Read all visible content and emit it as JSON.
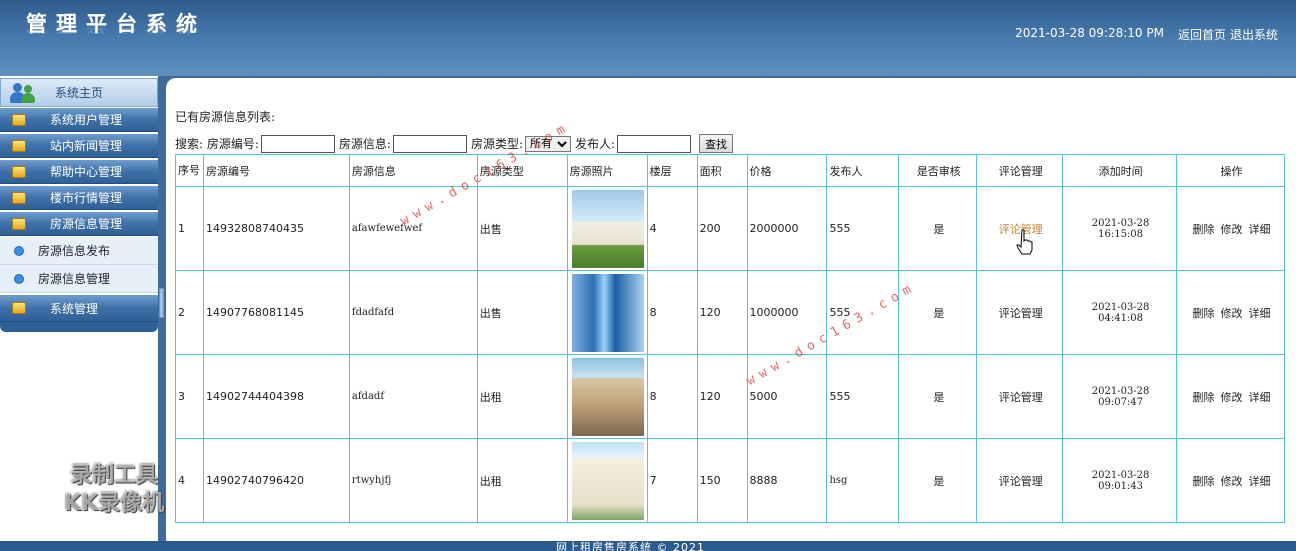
{
  "header": {
    "app_title": "管理平台系统",
    "datetime": "2021-03-28 09:28:10 PM",
    "home_link": "返回首页",
    "logout_link": "退出系统"
  },
  "sidebar": {
    "home": "系统主页",
    "items": [
      {
        "label": "系统用户管理"
      },
      {
        "label": "站内新闻管理"
      },
      {
        "label": "帮助中心管理"
      },
      {
        "label": "楼市行情管理"
      },
      {
        "label": "房源信息管理"
      }
    ],
    "sub_items": [
      {
        "label": "房源信息发布"
      },
      {
        "label": "房源信息管理"
      }
    ],
    "system_item": "系统管理"
  },
  "main": {
    "list_title": "已有房源信息列表:",
    "search": {
      "label": "搜索:",
      "field_id_label": "房源编号:",
      "field_info_label": "房源信息:",
      "field_type_label": "房源类型:",
      "type_selected": "所有",
      "field_publisher_label": "发布人:",
      "button": "查找"
    },
    "columns": [
      "序号",
      "房源编号",
      "房源信息",
      "房源类型",
      "房源照片",
      "楼层",
      "面积",
      "价格",
      "发布人",
      "是否审核",
      "评论管理",
      "添加时间",
      "操作"
    ],
    "rows": [
      {
        "no": "1",
        "code": "14932808740435",
        "info": "afawfewefwef",
        "type": "出售",
        "floor": "4",
        "area": "200",
        "price": "2000000",
        "publisher": "555",
        "approved": "是",
        "comment": "评论管理",
        "date": "2021-03-28",
        "time": "16:15:08"
      },
      {
        "no": "2",
        "code": "14907768081145",
        "info": "fdadfafd",
        "type": "出售",
        "floor": "8",
        "area": "120",
        "price": "1000000",
        "publisher": "555",
        "approved": "是",
        "comment": "评论管理",
        "date": "2021-03-28",
        "time": "04:41:08"
      },
      {
        "no": "3",
        "code": "14902744404398",
        "info": "afdadf",
        "type": "出租",
        "floor": "8",
        "area": "120",
        "price": "5000",
        "publisher": "555",
        "approved": "是",
        "comment": "评论管理",
        "date": "2021-03-28",
        "time": "09:07:47"
      },
      {
        "no": "4",
        "code": "14902740796420",
        "info": "rtwyhjfj",
        "type": "出租",
        "floor": "7",
        "area": "150",
        "price": "8888",
        "publisher": "hsg",
        "approved": "是",
        "comment": "评论管理",
        "date": "2021-03-28",
        "time": "09:01:43"
      }
    ],
    "ops": {
      "delete": "删除",
      "edit": "修改",
      "detail": "详细"
    }
  },
  "overlays": {
    "watermark": "www.doc163.com",
    "recorder_line1": "录制工具",
    "recorder_line2": "KK录像机"
  },
  "footer": {
    "text": "网上租房售房系统 © 2021"
  },
  "colors": {
    "header": "#3f6b98",
    "table_border": "#58c3d3",
    "hover_link": "#c8822a",
    "watermark": "#d63c3c"
  }
}
